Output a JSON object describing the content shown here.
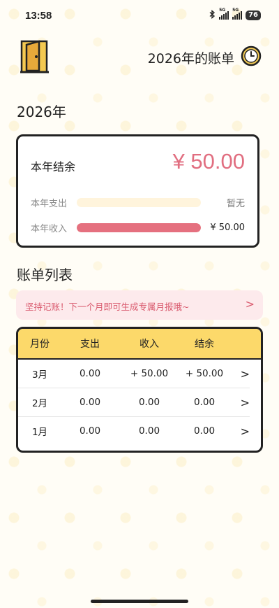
{
  "status_bar": {
    "time": "13:58",
    "network1": "5G",
    "network2": "5G",
    "battery": "76"
  },
  "header": {
    "title": "2026年的账单"
  },
  "year_heading": "2026年",
  "summary": {
    "balance_label": "本年结余",
    "balance_value": "¥ 50.00",
    "expense_label": "本年支出",
    "expense_value": "暂无",
    "expense_fraction": 0,
    "income_label": "本年收入",
    "income_value": "¥ 50.00",
    "income_fraction": 1,
    "colors": {
      "income_bar": "#e5707f",
      "track": "#fff4dc",
      "balance": "#e16e80"
    }
  },
  "list_heading": "账单列表",
  "tip": {
    "text": "坚持记账！下一个月即可生成专属月报哦~",
    "arrow": ">"
  },
  "table": {
    "headers": [
      "月份",
      "支出",
      "收入",
      "结余"
    ],
    "rows": [
      {
        "month": "3月",
        "expense": "0.00",
        "income": "+ 50.00",
        "balance": "+ 50.00",
        "arrow": ">"
      },
      {
        "month": "2月",
        "expense": "0.00",
        "income": "0.00",
        "balance": "0.00",
        "arrow": ">"
      },
      {
        "month": "1月",
        "expense": "0.00",
        "income": "0.00",
        "balance": "0.00",
        "arrow": ">"
      }
    ],
    "header_color": "#fcd96a"
  },
  "icons": [
    "door-icon",
    "clock-icon",
    "bluetooth-icon",
    "signal-icon",
    "battery-icon"
  ]
}
